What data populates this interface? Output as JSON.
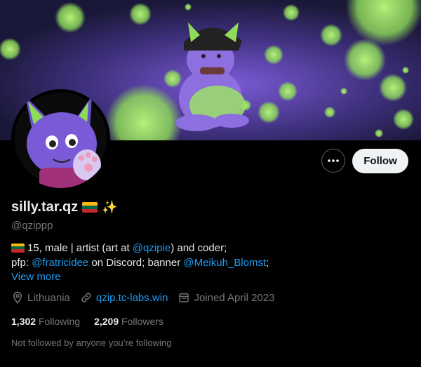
{
  "profile": {
    "display_name": "silly.tar.qz",
    "handle": "@qzippp",
    "follow_label": "Follow",
    "more_label": "•••",
    "bio": {
      "line1_prefix": "15, male | artist (art at ",
      "line1_mention": "@qzipie",
      "line1_suffix": ") and coder;",
      "line2_prefix": "pfp: ",
      "line2_mention1": "@fratricidee",
      "line2_middle": " on Discord; banner ",
      "line2_mention2": "@Meikuh_Blomst",
      "line2_suffix": ";"
    },
    "view_more": "View more",
    "location": "Lithuania",
    "website": "qzip.tc-labs.win",
    "joined": "Joined April 2023",
    "following_count": "1,302",
    "following_label": "Following",
    "followers_count": "2,209",
    "followers_label": "Followers",
    "not_followed_text": "Not followed by anyone you’re following"
  },
  "icons": {
    "location": "map-pin-icon",
    "website": "link-icon",
    "joined": "calendar-icon",
    "more": "more-dots-icon",
    "flag": "lithuania-flag-emoji",
    "sparkle": "sparkles-emoji"
  },
  "colors": {
    "background": "#000000",
    "accent": "#1d9bf0",
    "follow_button_bg": "#eff3f4",
    "muted_text": "#71767b",
    "banner_green": "#8fdc5a",
    "banner_purple": "#6c4fc9"
  }
}
